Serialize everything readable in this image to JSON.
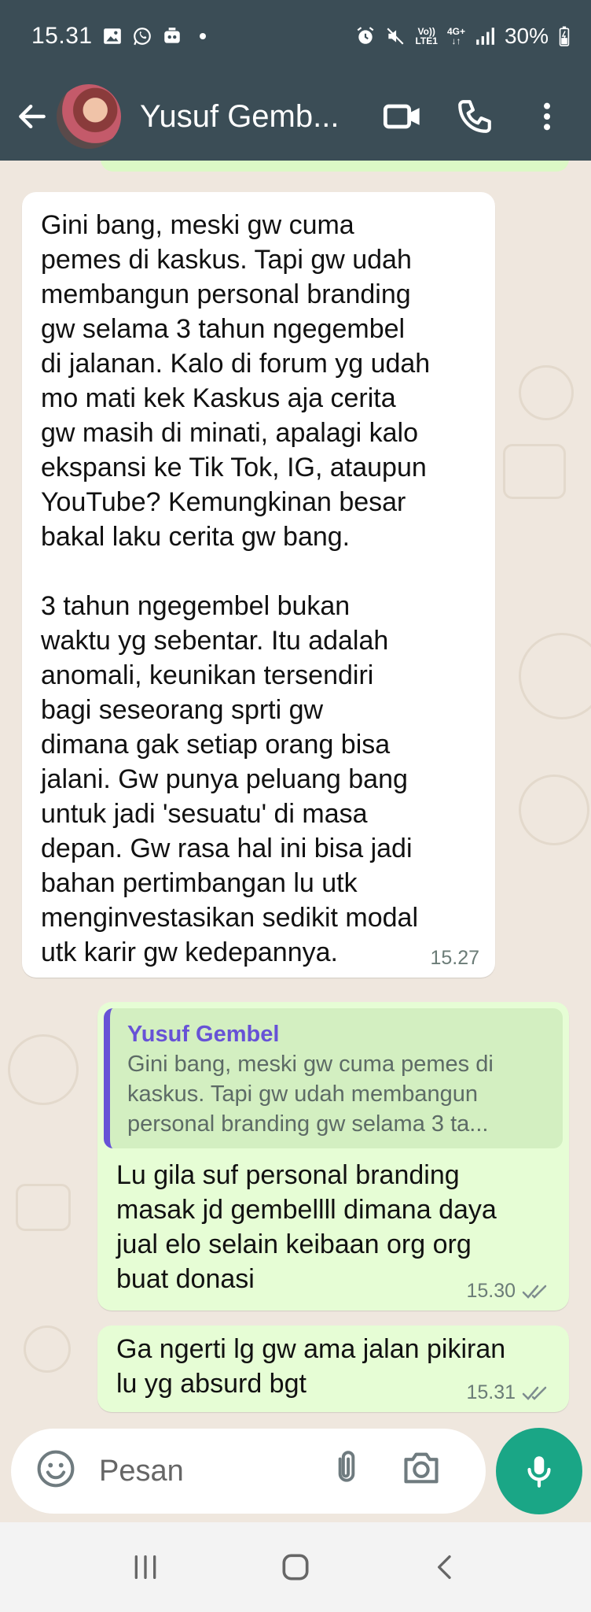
{
  "status_bar": {
    "time": "15.31",
    "network_top": "Vo))",
    "network_bottom": "LTE1",
    "network_type": "4G+",
    "battery": "30%"
  },
  "header": {
    "contact_name": "Yusuf Gemb...",
    "icons": [
      "back-arrow-icon",
      "video-call-icon",
      "phone-icon",
      "more-vert-icon"
    ]
  },
  "messages": [
    {
      "direction": "incoming",
      "text": "Gini bang, meski gw cuma\npemes di kaskus. Tapi gw udah\nmembangun personal branding\ngw selama 3 tahun ngegembel\ndi jalanan. Kalo di forum yg udah\nmo mati kek Kaskus aja cerita\ngw masih di minati, apalagi kalo\nekspansi ke Tik Tok, IG, ataupun\nYouTube? Kemungkinan besar\nbakal laku cerita gw bang.\n\n3 tahun ngegembel bukan\nwaktu yg sebentar. Itu adalah\nanomali, keunikan tersendiri\nbagi seseorang sprti gw\ndimana gak setiap orang bisa\njalani. Gw punya peluang bang\nuntuk jadi 'sesuatu' di masa\ndepan. Gw rasa hal ini bisa jadi\nbahan pertimbangan lu utk\nmenginvestasikan sedikit modal\nutk karir gw kedepannya.",
      "time": "15.27"
    },
    {
      "direction": "outgoing",
      "quote_author": "Yusuf Gembel",
      "quote_text": "Gini bang, meski gw cuma pemes di\nkaskus. Tapi gw udah membangun\npersonal branding gw selama 3 ta...",
      "text": "Lu gila suf personal branding\nmasak jd gembellll dimana daya\njual elo selain keibaan org org\nbuat donasi",
      "time": "15.30",
      "status": "read"
    },
    {
      "direction": "outgoing",
      "text": "Ga ngerti lg gw ama jalan pikiran\nlu yg absurd bgt",
      "time": "15.31",
      "status": "read"
    }
  ],
  "input": {
    "placeholder": "Pesan"
  },
  "colors": {
    "header": "#3b4d56",
    "chat_background": "#efe7de",
    "outgoing_bubble": "#e6fdd5",
    "incoming_bubble": "#ffffff",
    "accent": "#1aa686",
    "quote_accent": "#6752d6"
  }
}
